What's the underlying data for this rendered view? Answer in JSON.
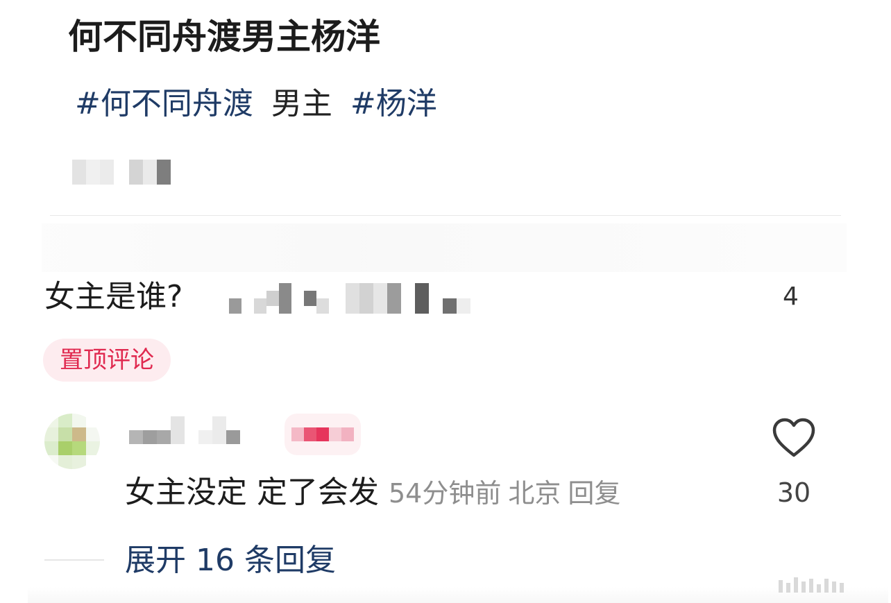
{
  "post": {
    "title": "何不同舟渡男主杨洋",
    "tag_1": "#何不同舟渡",
    "plain": "男主",
    "tag_2": "#杨洋"
  },
  "comment": {
    "question": "女主是谁?",
    "count": "4",
    "pinned_label": "置顶评论"
  },
  "reply": {
    "content": "女主没定 定了会发",
    "time": "54分钟前",
    "location": "北京",
    "reply_label": "回复",
    "like_count": "30",
    "like_icon": "heart-outline-icon"
  },
  "expand": {
    "label": "展开 16 条回复"
  },
  "colors": {
    "link": "#1f3b66",
    "pinned_text": "#e0294f",
    "pinned_bg": "#fdecef",
    "meta_text": "#8e8e8e"
  }
}
